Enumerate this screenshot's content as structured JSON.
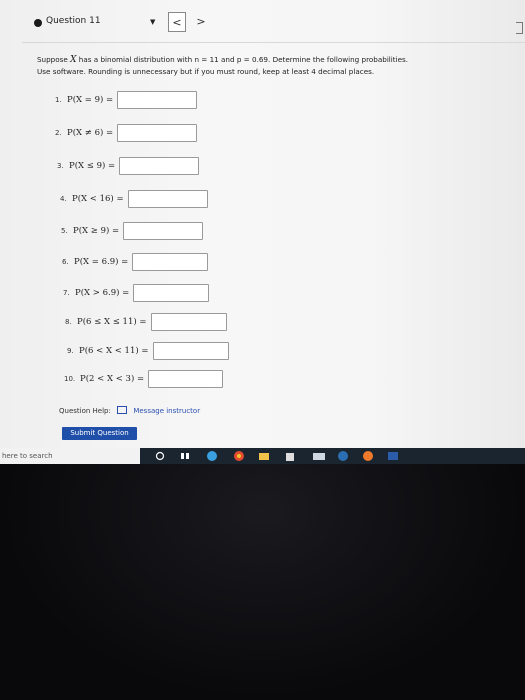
{
  "header": {
    "question_label": "Question 11",
    "prev": "<",
    "next": ">"
  },
  "prompt": {
    "line1_pre": "Suppose ",
    "var": "X",
    "line1_mid": " has a binomial distribution with n = 11 and p = 0.69. Determine the following probabilities.",
    "line2": "Use software. Rounding is unnecessary but if you must round, keep at least 4 decimal places."
  },
  "questions": [
    {
      "num": "1.",
      "expr": "P(X = 9) =",
      "value": ""
    },
    {
      "num": "2.",
      "expr": "P(X ≠ 6) =",
      "value": ""
    },
    {
      "num": "3.",
      "expr": "P(X ≤ 9) =",
      "value": ""
    },
    {
      "num": "4.",
      "expr": "P(X < 16) =",
      "value": ""
    },
    {
      "num": "5.",
      "expr": "P(X ≥ 9) =",
      "value": ""
    },
    {
      "num": "6.",
      "expr": "P(X = 6.9) =",
      "value": ""
    },
    {
      "num": "7.",
      "expr": "P(X > 6.9) =",
      "value": ""
    },
    {
      "num": "8.",
      "expr": "P(6 ≤ X ≤ 11) =",
      "value": ""
    },
    {
      "num": "9.",
      "expr": "P(6 < X < 11) =",
      "value": ""
    },
    {
      "num": "10.",
      "expr": "P(2 < X < 3) =",
      "value": ""
    }
  ],
  "help": {
    "label": "Question Help:",
    "link": "Message instructor"
  },
  "submit_label": "Submit Question",
  "taskbar": {
    "search_text": "here to search",
    "icons": [
      "search-icon",
      "task-view-icon",
      "edge-icon",
      "chrome-icon",
      "file-explorer-icon",
      "store-icon",
      "mail-icon",
      "steam-icon",
      "firefox-icon",
      "word-icon"
    ]
  }
}
